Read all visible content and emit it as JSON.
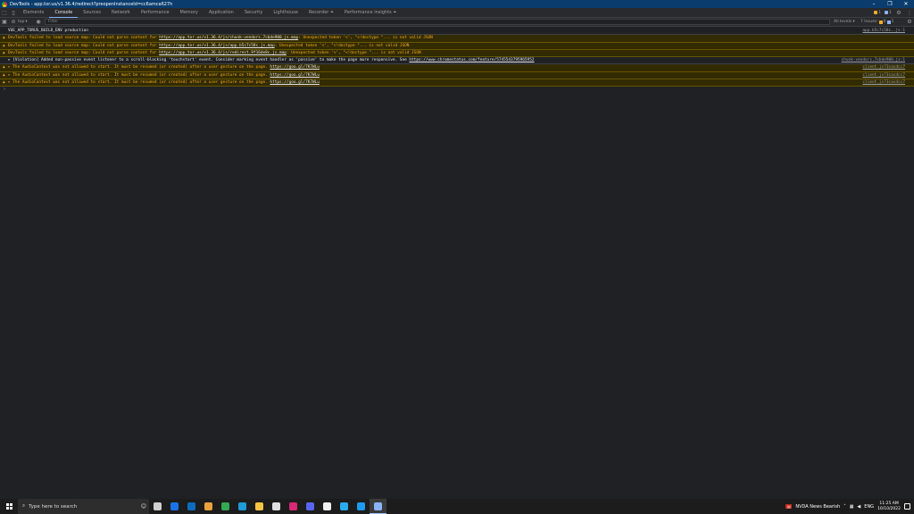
{
  "window": {
    "title": "DevTools - app.tor.us/v1.36.4/redirect?preopenInstanceId=cc6amca627h",
    "minimize": "–",
    "maximize": "❐",
    "close": "✕"
  },
  "tabs": [
    {
      "label": "Elements"
    },
    {
      "label": "Console"
    },
    {
      "label": "Sources"
    },
    {
      "label": "Network"
    },
    {
      "label": "Performance"
    },
    {
      "label": "Memory"
    },
    {
      "label": "Application"
    },
    {
      "label": "Security"
    },
    {
      "label": "Lighthouse"
    },
    {
      "label": "Recorder ⏶"
    },
    {
      "label": "Performance insights ⏶"
    }
  ],
  "tabbar_right": {
    "warnings_count": "1",
    "issues_count": "1",
    "more": "⋮"
  },
  "toolbar": {
    "context": "top",
    "filter_placeholder": "Filter",
    "levels": "All levels ▾",
    "issues_label": "7 Issues:",
    "issues_warn": "6",
    "issues_info": "1"
  },
  "console": {
    "rows": [
      {
        "type": "log",
        "text": "VUE_APP_TORUS_BUILD_ENV production",
        "link": "",
        "after": "",
        "source": "app.b5c7c58c..js:1"
      },
      {
        "type": "warn",
        "text": "DevTools failed to load source map: Could not parse content for ",
        "link": "https://app.tor.us/v1.36.4/js/chunk-vendors.7cbde900.js.map",
        "after": ": Unexpected token '<', \"<!doctype \"... is not valid JSON",
        "source": ""
      },
      {
        "type": "warn",
        "text": "DevTools failed to load source map: Could not parse content for ",
        "link": "https://app.tor.us/v1.36.4/js/app.b5c7c58c.js.map",
        "after": ": Unexpected token '<', \"<!doctype \"... is not valid JSON",
        "source": ""
      },
      {
        "type": "warn",
        "text": "DevTools failed to load source map: Could not parse content for ",
        "link": "https://app.tor.us/v1.36.4/js/redirect.9f16de8c.js.map",
        "after": ": Unexpected token '<', \"<!doctype \"... is not valid JSON",
        "source": ""
      },
      {
        "type": "log",
        "text": "▸ [Violation] Added non-passive event listener to a scroll-blocking 'touchstart' event. Consider marking event handler as 'passive' to make the page more responsive. See ",
        "link": "https://www.chromestatus.com/feature/5745543795965952",
        "after": "",
        "source": "chunk-vendors.7cbde900.js:1"
      },
      {
        "type": "warn",
        "text": "▸ The AudioContext was not allowed to start. It must be resumed (or created) after a user gesture on the page. ",
        "link": "https://goo.gl/7K7WLu",
        "after": "",
        "source": "client.js?3cacdcc7"
      },
      {
        "type": "warn",
        "text": "▸ The AudioContext was not allowed to start. It must be resumed (or created) after a user gesture on the page. ",
        "link": "https://goo.gl/7K7WLu",
        "after": "",
        "source": "client.js?3cacdcc7"
      },
      {
        "type": "warn",
        "text": "▸ The AudioContext was not allowed to start. It must be resumed (or created) after a user gesture on the page. ",
        "link": "https://goo.gl/7K7WLu",
        "after": "",
        "source": "client.js?3cacdcc7"
      }
    ],
    "prompt": "›"
  },
  "taskbar": {
    "search_placeholder": "Type here to search",
    "apps": [
      {
        "name": "task-view-icon",
        "color": "#cfcfcf"
      },
      {
        "name": "mail-icon",
        "color": "#1a73e8"
      },
      {
        "name": "calendar-icon",
        "color": "#0f6cbd"
      },
      {
        "name": "chrome-profile-icon",
        "color": "#e8a33d"
      },
      {
        "name": "chrome-icon",
        "color": "#34a853"
      },
      {
        "name": "edge-icon",
        "color": "#1e9bd7"
      },
      {
        "name": "file-explorer-icon",
        "color": "#f4c542"
      },
      {
        "name": "store-icon",
        "color": "#e0e0e0"
      },
      {
        "name": "instagram-icon",
        "color": "#d62976"
      },
      {
        "name": "discord-icon",
        "color": "#5865f2"
      },
      {
        "name": "app-icon",
        "color": "#f0f0f0"
      },
      {
        "name": "telegram-icon",
        "color": "#2aabee"
      },
      {
        "name": "twitter-icon",
        "color": "#1d9bf0"
      },
      {
        "name": "chrome-devtools-icon",
        "color": "#8ab4f8"
      }
    ],
    "news": "NVDA News Bearish",
    "lang": "ENG",
    "time": "11:25 AM",
    "date": "10/10/2022"
  }
}
